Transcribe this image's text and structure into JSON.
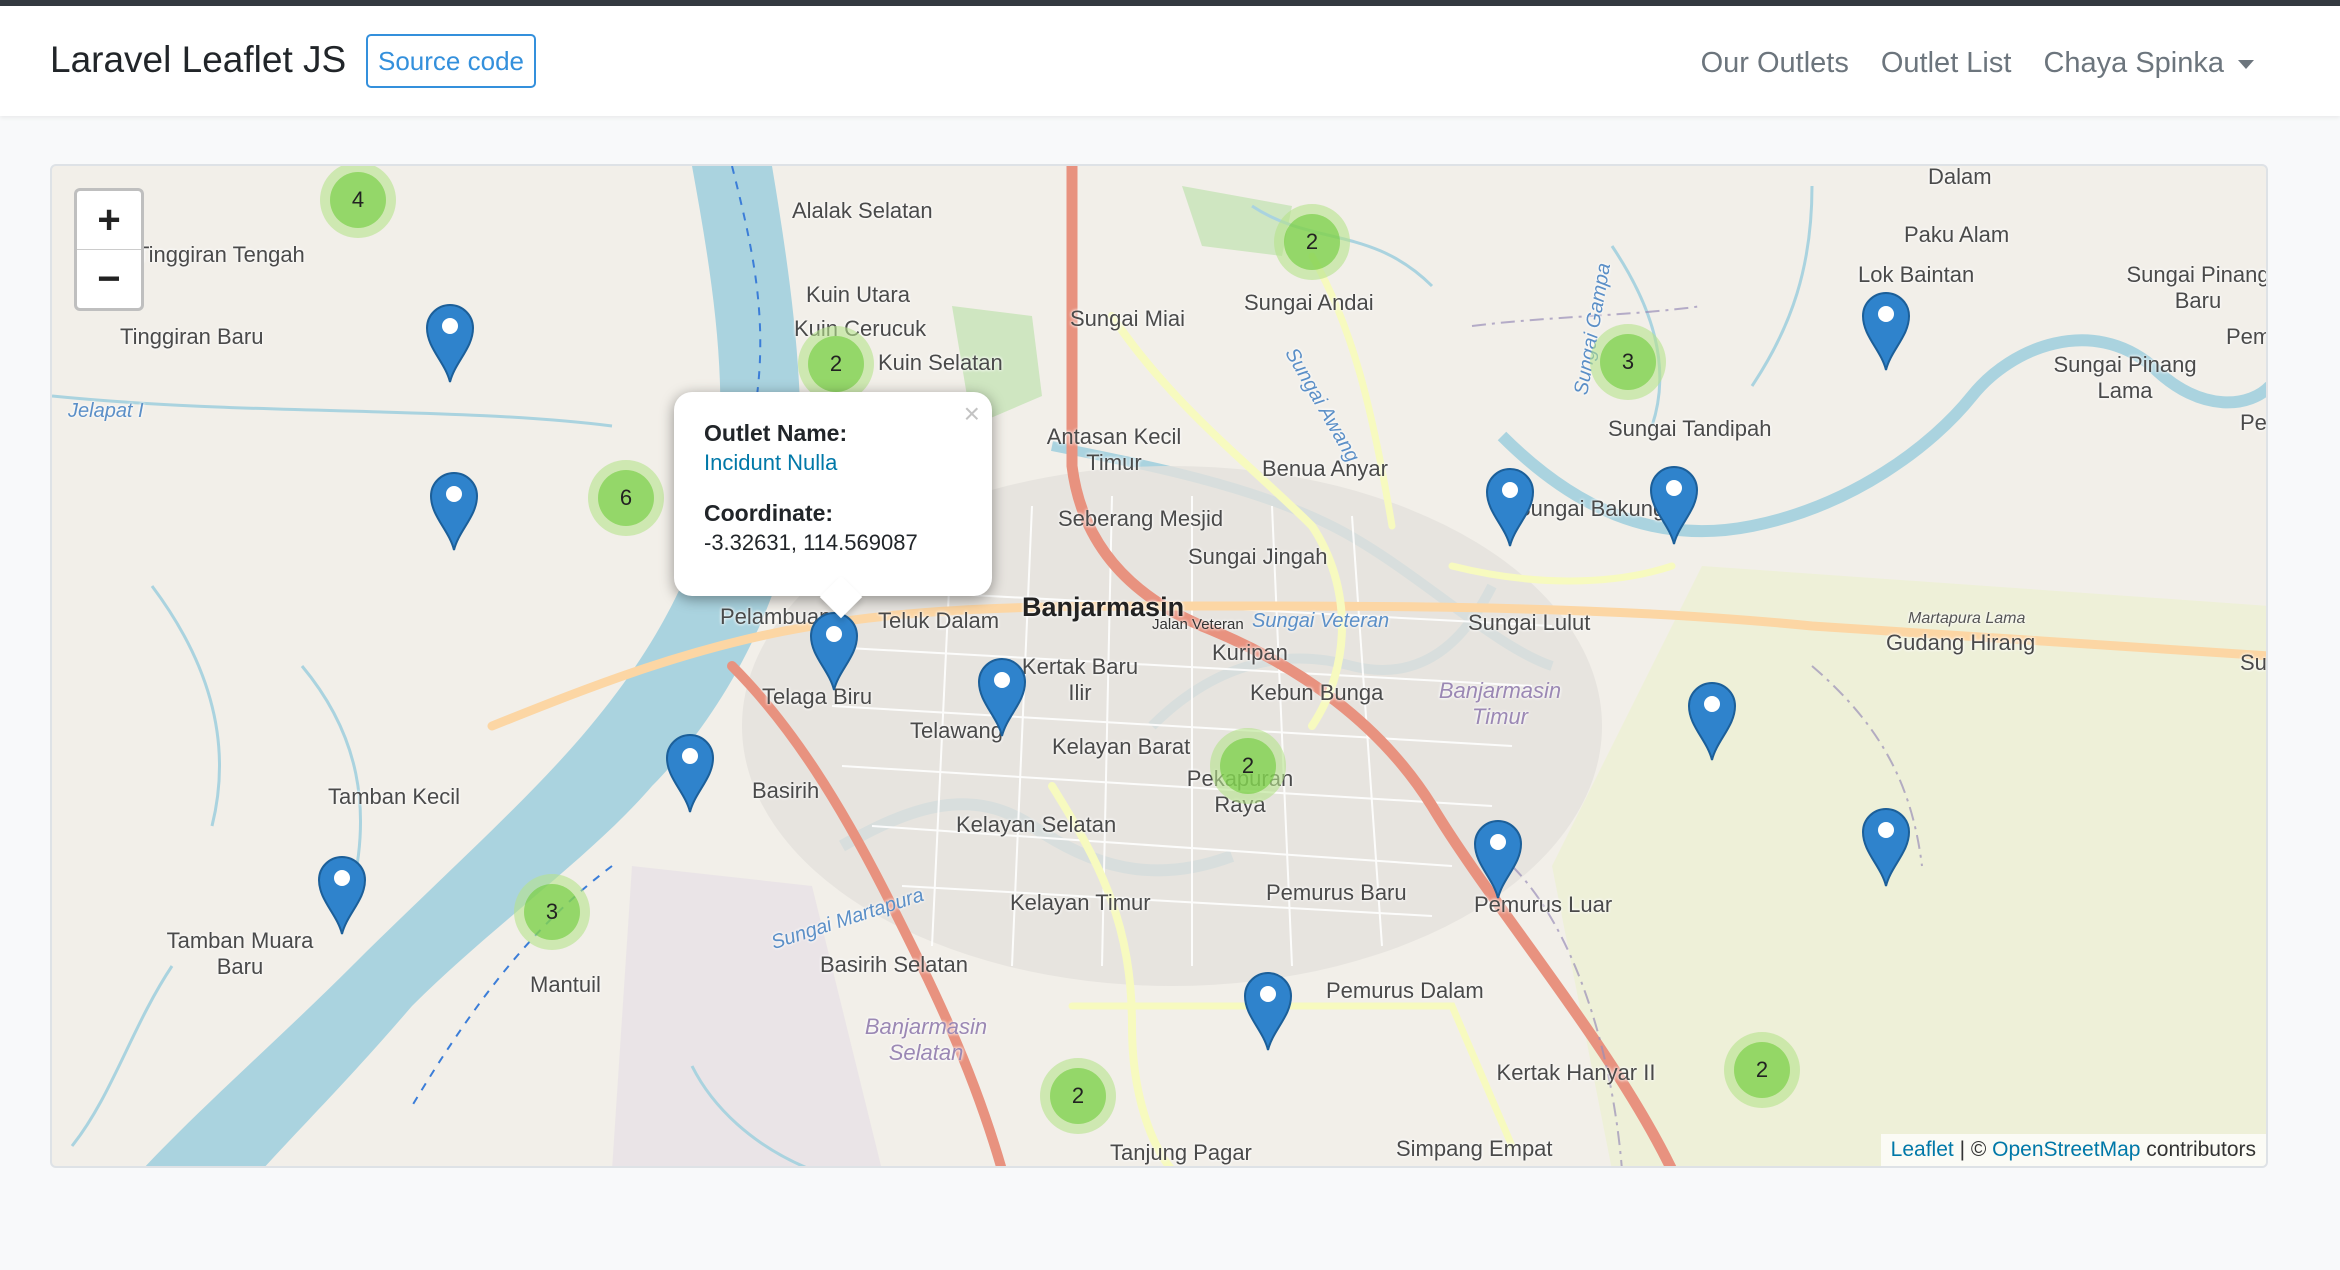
{
  "navbar": {
    "brand": "Laravel Leaflet JS",
    "source_button": "Source code",
    "links": [
      "Our Outlets",
      "Outlet List"
    ],
    "user_menu": "Chaya Spinka"
  },
  "map": {
    "zoom_in": "+",
    "zoom_out": "−",
    "place_labels": [
      "Alalak Selatan",
      "Tinggiran Tengah",
      "Tinggiran Baru",
      "Jelapat I",
      "Kuin Utara",
      "Kuin Cerucuk",
      "Kuin Selatan",
      "Sungai Miai",
      "Sungai Andai",
      "Antasan Kecil Timur",
      "Benua Anyar",
      "Seberang Mesjid",
      "Sungai Jingah",
      "Teluk Dalam",
      "Banjarmasin",
      "Kuripan",
      "Kertak Baru Ilir",
      "Kebun Bunga",
      "Telaga Biru",
      "Telawang",
      "Kelayan Barat",
      "Pekapuran Raya",
      "Basirih",
      "Kelayan Selatan",
      "Kelayan Timur",
      "Pemurus Baru",
      "Pemurus Luar",
      "Tamban Kecil",
      "Tamban Muara Baru",
      "Mantuil",
      "Basirih Selatan",
      "Pemurus Dalam",
      "Tanjung Pagar",
      "Simpang Empat",
      "Kertak Hanyar II",
      "Paku Alam",
      "Lok Baintan",
      "Sungai Pinang Baru",
      "Sungai Pinang Lama",
      "Sungai Tandipah",
      "Sungai Bakung",
      "Sungai Lulut",
      "Gudang Hirang",
      "Martapura Lama",
      "Banjarmasin Timur",
      "Banjarmasin Selatan",
      "Jalan Veteran",
      "Dalam",
      "Pelambuan",
      "Sungai Veteran",
      "Sungai Martapura",
      "Sungai Awang",
      "Sungai Gampa",
      "Peml",
      "Pen",
      "Sung"
    ],
    "clusters": [
      "4",
      "2",
      "2",
      "3",
      "6",
      "2",
      "3",
      "2",
      "2"
    ],
    "popup": {
      "name_label": "Outlet Name:",
      "name_value": "Incidunt Nulla",
      "coord_label": "Coordinate:",
      "coord_value": "-3.32631, 114.569087",
      "close": "×"
    },
    "attribution": {
      "leaflet": "Leaflet",
      "sep": " | © ",
      "osm": "OpenStreetMap",
      "suffix": " contributors"
    }
  }
}
